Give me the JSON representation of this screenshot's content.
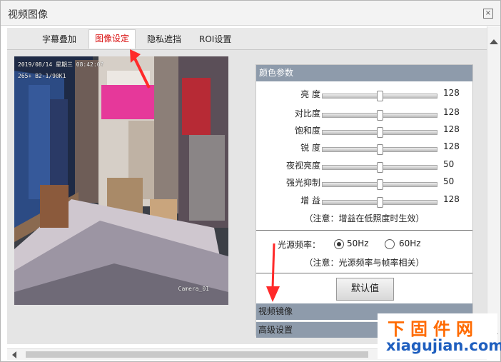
{
  "window": {
    "title": "视频图像",
    "close_icon": "close-icon"
  },
  "tabs": [
    {
      "label": "字幕叠加",
      "active": false
    },
    {
      "label": "图像设定",
      "active": true
    },
    {
      "label": "隐私遮挡",
      "active": false
    },
    {
      "label": "ROI设置",
      "active": false
    }
  ],
  "video": {
    "timestamp_line1": "2019/08/14 星期三 08:42:0?",
    "timestamp_line2": "265+ B2-1/90K1",
    "camera_label": "Camera_01"
  },
  "panel": {
    "header": "颜色参数",
    "sliders": [
      {
        "label": "亮    度",
        "value": "128",
        "level": 0.5
      },
      {
        "label": "对比度",
        "value": "128",
        "level": 0.5
      },
      {
        "label": "饱和度",
        "value": "128",
        "level": 0.5
      },
      {
        "label": "锐    度",
        "value": "128",
        "level": 0.5
      },
      {
        "label": "夜视亮度",
        "value": "50",
        "level": 0.5
      },
      {
        "label": "强光抑制",
        "value": "50",
        "level": 0.5
      },
      {
        "label": "增    益",
        "value": "128",
        "level": 0.5
      }
    ],
    "gain_note": "（注意：增益在低照度时生效）",
    "light_freq_label": "光源频率：",
    "light_freq_options": [
      {
        "label": "50Hz",
        "checked": true
      },
      {
        "label": "60Hz",
        "checked": false
      }
    ],
    "freq_note": "（注意：光源频率与帧率相关）",
    "default_button": "默认值",
    "accordion": [
      {
        "label": "视频镜像"
      },
      {
        "label": "高级设置"
      }
    ]
  },
  "watermark": {
    "line1": "下固件网",
    "line2": "xiagujian.com"
  },
  "colors": {
    "active_tab": "#d90f0f",
    "panel_header": "#8e9bab",
    "watermark_orange": "#ff6a00",
    "watermark_blue": "#1f5fbf"
  }
}
